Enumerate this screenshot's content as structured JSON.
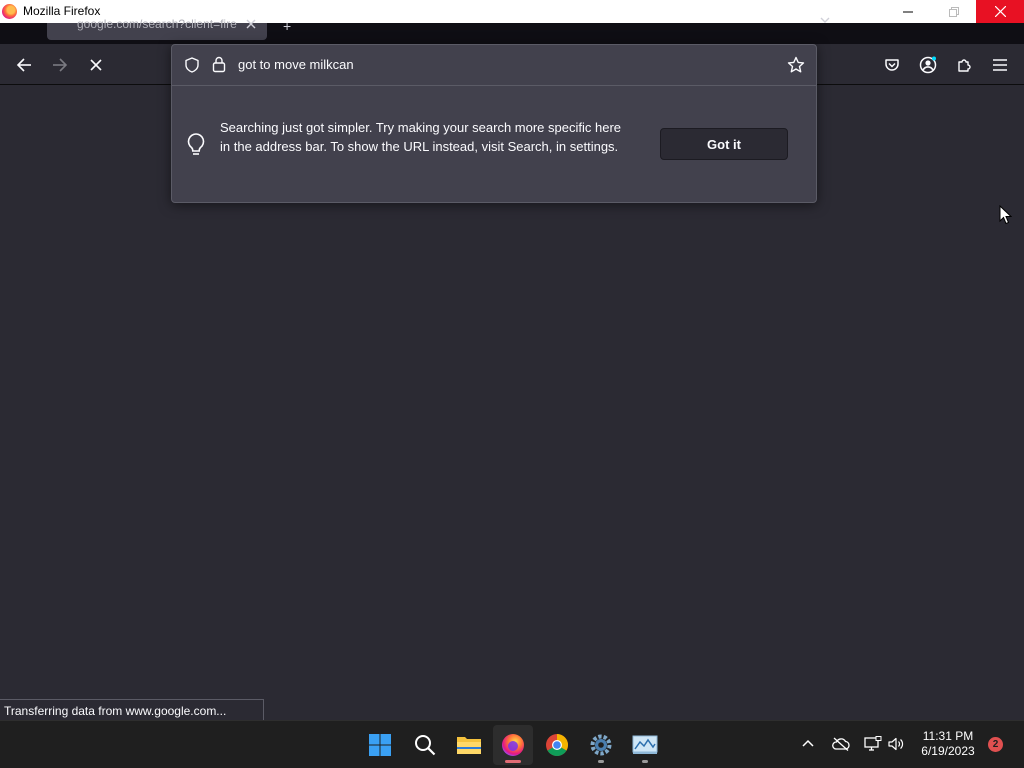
{
  "window": {
    "title": "Mozilla Firefox"
  },
  "tab": {
    "label": "google.com/search?client=fire"
  },
  "urlbar": {
    "query": "got to move milkcan"
  },
  "tip": {
    "text": "Searching just got simpler. Try making your search more specific here in the address bar. To show the URL instead, visit Search, in settings.",
    "button_label": "Got it"
  },
  "status": {
    "text": "Transferring data from www.google.com..."
  },
  "taskbar": {
    "time": "11:31 PM",
    "date": "6/19/2023",
    "notification_count": "2"
  },
  "colors": {
    "toolbar_bg": "#2b2a33",
    "popup_bg": "#42414d",
    "close_red": "#e81123",
    "taskbar_bg": "#1f1f1f",
    "badge": "#e05050"
  },
  "icons": {
    "back": "arrow-left-icon",
    "forward": "arrow-right-icon",
    "stop": "close-icon",
    "shield": "shield-icon",
    "lock": "lock-icon",
    "bookmark": "star-icon",
    "pocket": "pocket-icon",
    "account": "account-icon",
    "extensions": "puzzle-icon",
    "menu": "hamburger-icon",
    "tip": "lightbulb-icon"
  }
}
